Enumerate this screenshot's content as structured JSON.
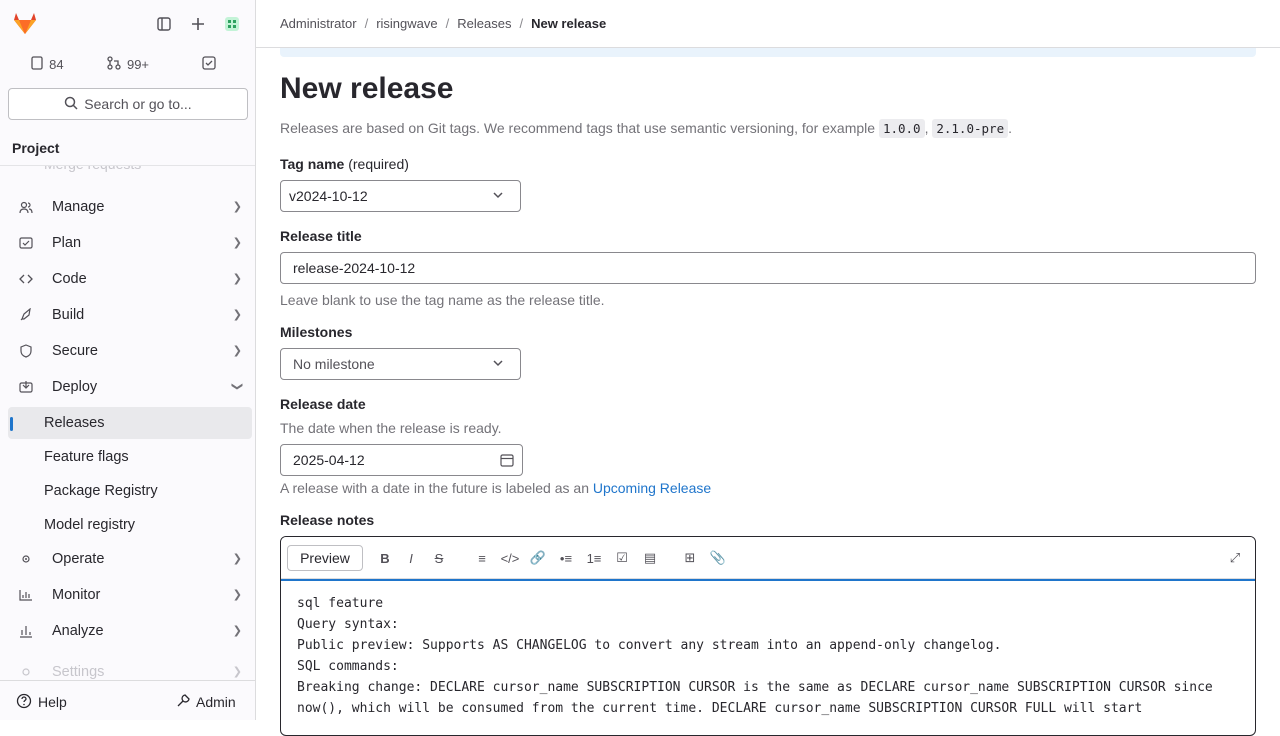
{
  "sidebar": {
    "counts": {
      "issues": "84",
      "merge_requests": "99+"
    },
    "search_label": "Search or go to...",
    "section_title": "Project",
    "faded_item": "Merge requests",
    "items": [
      {
        "label": "Manage"
      },
      {
        "label": "Plan"
      },
      {
        "label": "Code"
      },
      {
        "label": "Build"
      },
      {
        "label": "Secure"
      },
      {
        "label": "Deploy"
      },
      {
        "label": "Releases"
      },
      {
        "label": "Feature flags"
      },
      {
        "label": "Package Registry"
      },
      {
        "label": "Model registry"
      },
      {
        "label": "Operate"
      },
      {
        "label": "Monitor"
      },
      {
        "label": "Analyze"
      },
      {
        "label": "Settings"
      }
    ],
    "help_label": "Help",
    "admin_label": "Admin"
  },
  "breadcrumb": [
    "Administrator",
    "risingwave",
    "Releases",
    "New release"
  ],
  "page": {
    "title": "New release",
    "intro_text": "Releases are based on Git tags. We recommend tags that use semantic versioning, for example",
    "example_tag_1": "1.0.0",
    "example_tag_2": "2.1.0-pre",
    "tag_label": "Tag name",
    "tag_required": "(required)",
    "tag_value": "v2024-10-12",
    "title_label": "Release title",
    "title_value": "release-2024-10-12",
    "title_help": "Leave blank to use the tag name as the release title.",
    "milestones_label": "Milestones",
    "milestones_value": "No milestone",
    "date_label": "Release date",
    "date_help": "The date when the release is ready.",
    "date_value": "2025-04-12",
    "future_text": "A release with a date in the future is labeled as an",
    "future_link": "Upcoming Release",
    "notes_label": "Release notes",
    "preview_label": "Preview",
    "notes_text": "sql feature\nQuery syntax:\nPublic preview: Supports AS CHANGELOG to convert any stream into an append-only changelog.\nSQL commands:\nBreaking change: DECLARE cursor_name SUBSCRIPTION CURSOR is the same as DECLARE cursor_name SUBSCRIPTION CURSOR since now(), which will be consumed from the current time. DECLARE cursor_name SUBSCRIPTION CURSOR FULL will start"
  },
  "colors": {
    "accent": "#1f75cb",
    "text": "#28272d",
    "muted": "#737278"
  }
}
